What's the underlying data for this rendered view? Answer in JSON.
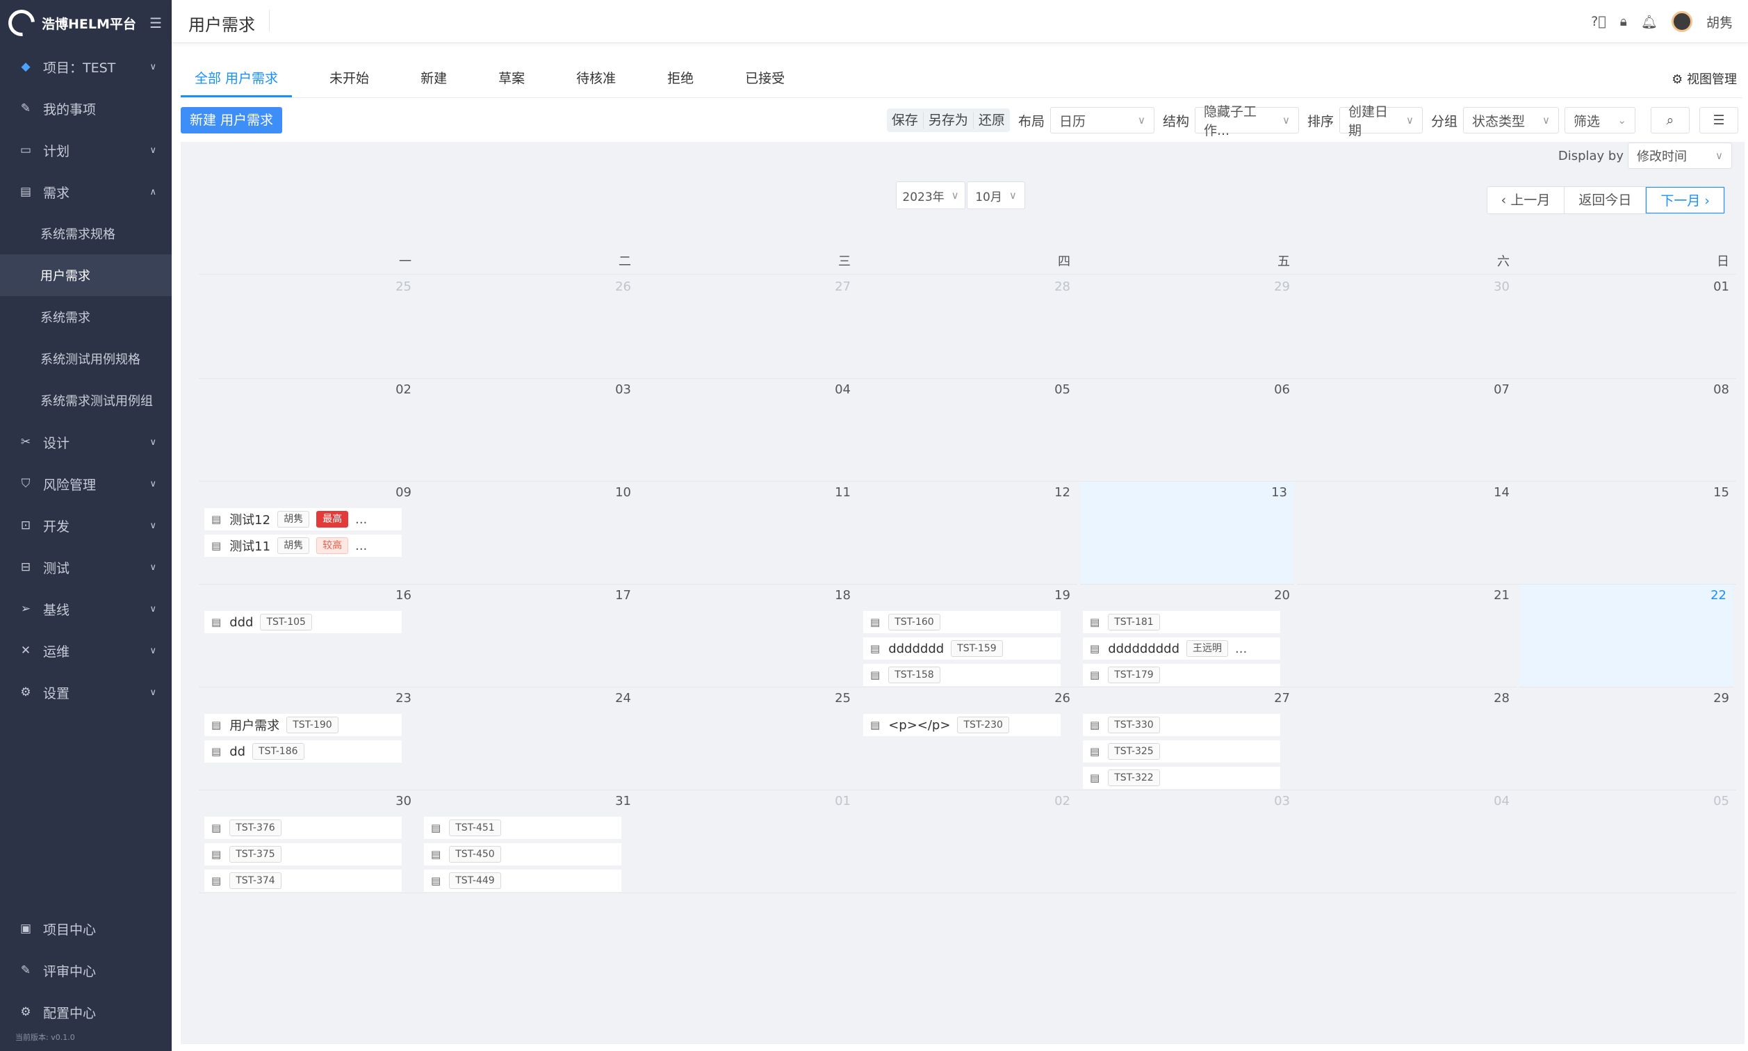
{
  "app": {
    "name": "浩博HELM平台",
    "version": "当前版本: v0.1.0"
  },
  "sidebar": {
    "project": "项目：TEST",
    "items": [
      {
        "label": "我的事项",
        "icon": "edit-icon",
        "chevron": false
      },
      {
        "label": "计划",
        "icon": "calendar-icon",
        "chevron": true
      },
      {
        "label": "需求",
        "icon": "list-icon",
        "chevron": true,
        "expanded": true
      }
    ],
    "sub_items": [
      "系统需求规格",
      "用户需求",
      "系统需求",
      "系统测试用例规格",
      "系统需求测试用例组"
    ],
    "items2": [
      {
        "label": "设计",
        "icon": "design-icon"
      },
      {
        "label": "风险管理",
        "icon": "shield-icon"
      },
      {
        "label": "开发",
        "icon": "code-icon"
      },
      {
        "label": "测试",
        "icon": "test-icon"
      },
      {
        "label": "基线",
        "icon": "send-icon"
      },
      {
        "label": "运维",
        "icon": "tools-icon"
      },
      {
        "label": "设置",
        "icon": "gear-icon"
      }
    ],
    "bottom": [
      {
        "label": "项目中心",
        "icon": "project-icon"
      },
      {
        "label": "评审中心",
        "icon": "review-icon"
      },
      {
        "label": "配置中心",
        "icon": "config-icon"
      }
    ]
  },
  "header": {
    "title": "用户需求",
    "user": "胡隽"
  },
  "tabs": [
    "全部 用户需求",
    "未开始",
    "新建",
    "草案",
    "待核准",
    "拒绝",
    "已接受"
  ],
  "view_mgmt": "视图管理",
  "toolbar": {
    "new_button": "新建 用户需求",
    "save": "保存",
    "save_as": "另存为",
    "restore": "还原",
    "layout_label": "布局",
    "layout_value": "日历",
    "structure_label": "结构",
    "structure_value": "隐藏子工作...",
    "sort_label": "排序",
    "sort_value": "创建日期",
    "group_label": "分组",
    "group_value": "状态类型",
    "filter": "筛选"
  },
  "calendar": {
    "display_by_label": "Display by",
    "display_by_value": "修改时间",
    "year": "2023年",
    "month": "10月",
    "prev": "上一月",
    "today": "返回今日",
    "next": "下一月",
    "weekdays": [
      "一",
      "二",
      "三",
      "四",
      "五",
      "六",
      "日"
    ],
    "days": [
      {
        "d": "25",
        "o": true
      },
      {
        "d": "26",
        "o": true
      },
      {
        "d": "27",
        "o": true
      },
      {
        "d": "28",
        "o": true
      },
      {
        "d": "29",
        "o": true
      },
      {
        "d": "30",
        "o": true
      },
      {
        "d": "01"
      },
      {
        "d": "02"
      },
      {
        "d": "03"
      },
      {
        "d": "04"
      },
      {
        "d": "05"
      },
      {
        "d": "06"
      },
      {
        "d": "07"
      },
      {
        "d": "08"
      },
      {
        "d": "09",
        "ev": [
          {
            "t": "测试12",
            "tags": [
              {
                "x": "胡隽"
              },
              {
                "x": "最高",
                "c": "high"
              }
            ],
            "more": true
          },
          {
            "t": "测试11",
            "tags": [
              {
                "x": "胡隽"
              },
              {
                "x": "较高",
                "c": "mid"
              }
            ],
            "more": true
          }
        ]
      },
      {
        "d": "10"
      },
      {
        "d": "11"
      },
      {
        "d": "12"
      },
      {
        "d": "13",
        "sel": true
      },
      {
        "d": "14"
      },
      {
        "d": "15"
      },
      {
        "d": "16",
        "ev": [
          {
            "t": "ddd",
            "tags": [
              {
                "x": "TST-105"
              }
            ]
          }
        ]
      },
      {
        "d": "17"
      },
      {
        "d": "18"
      },
      {
        "d": "19",
        "ev": [
          {
            "t": "",
            "tags": [
              {
                "x": "TST-160"
              }
            ]
          },
          {
            "t": "ddddddd",
            "tags": [
              {
                "x": "TST-159"
              }
            ]
          },
          {
            "t": "",
            "tags": [
              {
                "x": "TST-158"
              }
            ]
          }
        ]
      },
      {
        "d": "20",
        "ev": [
          {
            "t": "",
            "tags": [
              {
                "x": "TST-181"
              }
            ]
          },
          {
            "t": "ddddddddd",
            "tags": [
              {
                "x": "王远明"
              }
            ],
            "more": true
          },
          {
            "t": "",
            "tags": [
              {
                "x": "TST-179"
              }
            ]
          }
        ]
      },
      {
        "d": "21"
      },
      {
        "d": "22",
        "today": true
      },
      {
        "d": "23",
        "ev": [
          {
            "t": "用户需求",
            "tags": [
              {
                "x": "TST-190"
              }
            ]
          },
          {
            "t": "dd",
            "tags": [
              {
                "x": "TST-186"
              }
            ]
          }
        ]
      },
      {
        "d": "24"
      },
      {
        "d": "25"
      },
      {
        "d": "26",
        "ev": [
          {
            "t": "<p></p>",
            "tags": [
              {
                "x": "TST-230"
              }
            ]
          }
        ]
      },
      {
        "d": "27",
        "ev": [
          {
            "t": "",
            "tags": [
              {
                "x": "TST-330"
              }
            ]
          },
          {
            "t": "",
            "tags": [
              {
                "x": "TST-325"
              }
            ]
          },
          {
            "t": "",
            "tags": [
              {
                "x": "TST-322"
              }
            ]
          }
        ]
      },
      {
        "d": "28"
      },
      {
        "d": "29"
      },
      {
        "d": "30",
        "ev": [
          {
            "t": "",
            "tags": [
              {
                "x": "TST-376"
              }
            ]
          },
          {
            "t": "",
            "tags": [
              {
                "x": "TST-375"
              }
            ]
          },
          {
            "t": "",
            "tags": [
              {
                "x": "TST-374"
              }
            ]
          }
        ]
      },
      {
        "d": "31",
        "ev": [
          {
            "t": "",
            "tags": [
              {
                "x": "TST-451"
              }
            ]
          },
          {
            "t": "",
            "tags": [
              {
                "x": "TST-450"
              }
            ]
          },
          {
            "t": "",
            "tags": [
              {
                "x": "TST-449"
              }
            ]
          }
        ]
      },
      {
        "d": "01",
        "o": true
      },
      {
        "d": "02",
        "o": true
      },
      {
        "d": "03",
        "o": true
      },
      {
        "d": "04",
        "o": true
      },
      {
        "d": "05",
        "o": true
      }
    ]
  },
  "colors": {
    "sidebar_bg": "#2c3346",
    "accent": "#1890ff",
    "primary_btn": "#3e8ef7",
    "tag_high": "#e33a3a"
  }
}
